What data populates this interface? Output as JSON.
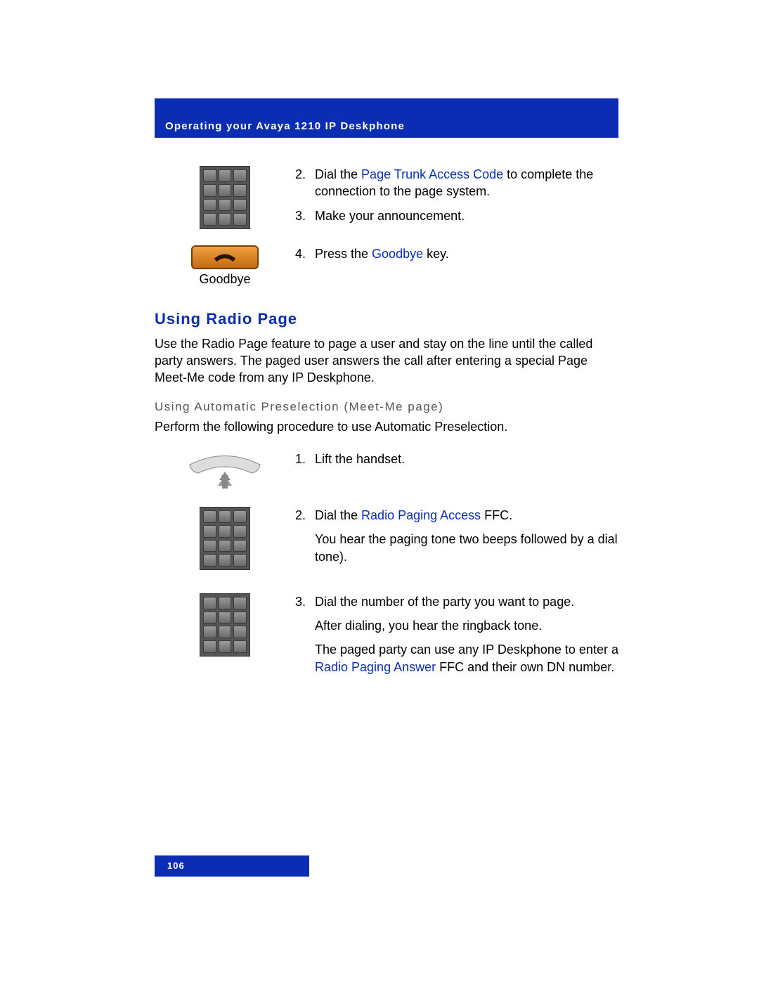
{
  "header": "Operating your Avaya 1210 IP Deskphone",
  "page_number": "106",
  "top_steps": {
    "s2_num": "2.",
    "s2_a": "Dial the ",
    "s2_link": "Page Trunk Access Code",
    "s2_b": " to complete the connection to the page system.",
    "s3_num": "3.",
    "s3": "Make your announcement.",
    "s4_num": "4.",
    "s4_a": "Press the ",
    "s4_link": "Goodbye",
    "s4_b": " key.",
    "goodbye_label": "Goodbye"
  },
  "section": {
    "title": "Using Radio Page",
    "intro": "Use the Radio Page feature to page a user and stay on the line until the called party answers. The paged user answers the call after entering a special Page Meet-Me code from any IP Deskphone.",
    "subtitle": "Using Automatic Preselection (Meet-Me page)",
    "subintro": "Perform the following procedure to use Automatic Preselection."
  },
  "steps": {
    "s1_num": "1.",
    "s1": "Lift the handset.",
    "s2_num": "2.",
    "s2_a": "Dial the ",
    "s2_link": "Radio Paging Access",
    "s2_b": " FFC.",
    "s2_note": "You hear the paging tone two beeps followed by a dial tone).",
    "s3_num": "3.",
    "s3": "Dial the number of the party you want to page.",
    "s3_note": "After dialing, you hear the ringback tone.",
    "s3_tail_a": "The paged party can use any IP Deskphone to enter a ",
    "s3_link": "Radio Paging Answer",
    "s3_tail_b": " FFC and their own DN number."
  }
}
